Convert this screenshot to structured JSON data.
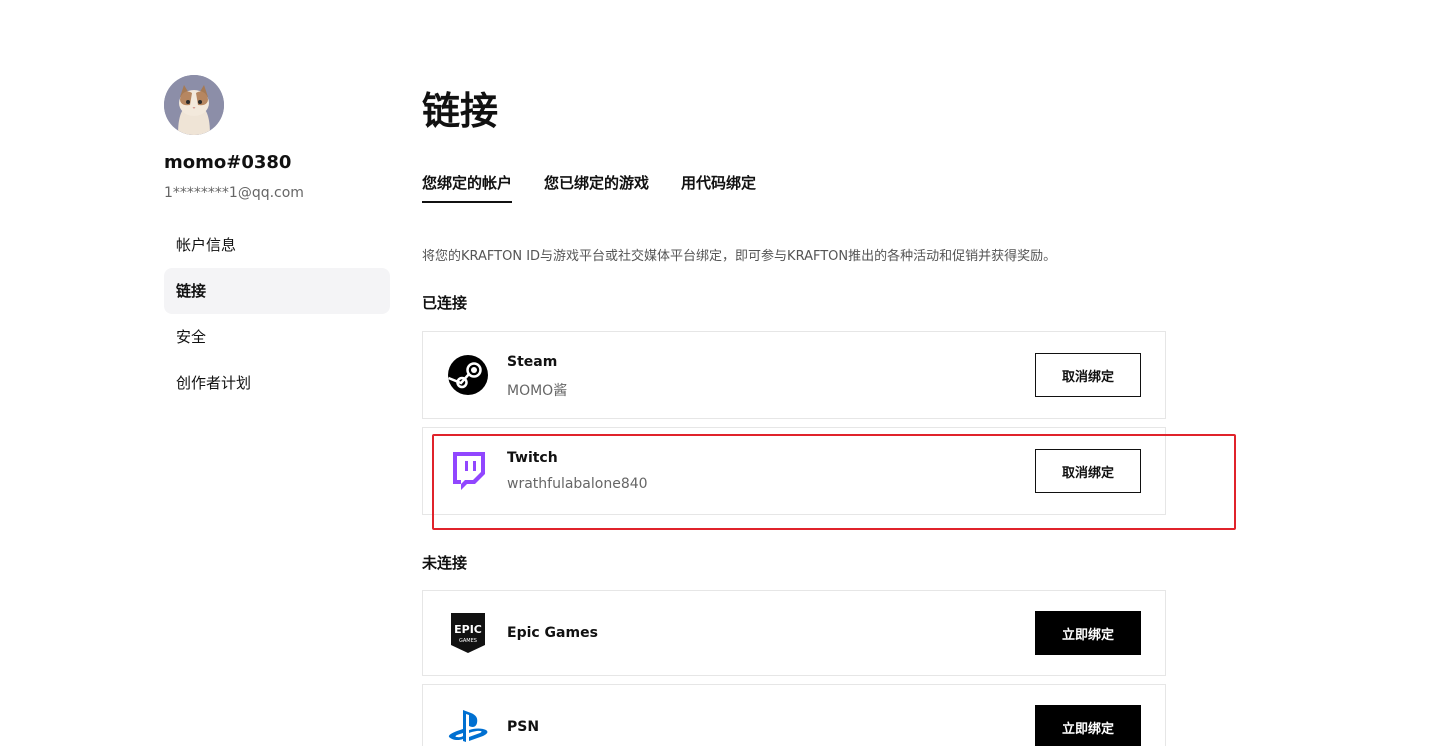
{
  "user": {
    "name": "momo#0380",
    "email": "1********1@qq.com"
  },
  "sidebar": {
    "items": [
      {
        "label": "帐户信息"
      },
      {
        "label": "链接"
      },
      {
        "label": "安全"
      },
      {
        "label": "创作者计划"
      }
    ]
  },
  "main": {
    "title": "链接",
    "tabs": [
      {
        "label": "您绑定的帐户"
      },
      {
        "label": "您已绑定的游戏"
      },
      {
        "label": "用代码绑定"
      }
    ],
    "description": "将您的KRAFTON ID与游戏平台或社交媒体平台绑定，即可参与KRAFTON推出的各种活动和促销并获得奖励。",
    "connected_title": "已连接",
    "not_connected_title": "未连接",
    "connected": [
      {
        "name": "Steam",
        "account": "MOMO酱",
        "button": "取消绑定",
        "icon": "steam-icon"
      },
      {
        "name": "Twitch",
        "account": "wrathfulabalone840",
        "button": "取消绑定",
        "icon": "twitch-icon"
      }
    ],
    "not_connected": [
      {
        "name": "Epic Games",
        "button": "立即绑定",
        "icon": "epic-games-icon"
      },
      {
        "name": "PSN",
        "button": "立即绑定",
        "icon": "playstation-icon"
      }
    ]
  },
  "colors": {
    "highlight": "#e0232b",
    "twitch": "#9146ff",
    "playstation": "#0070d1"
  }
}
